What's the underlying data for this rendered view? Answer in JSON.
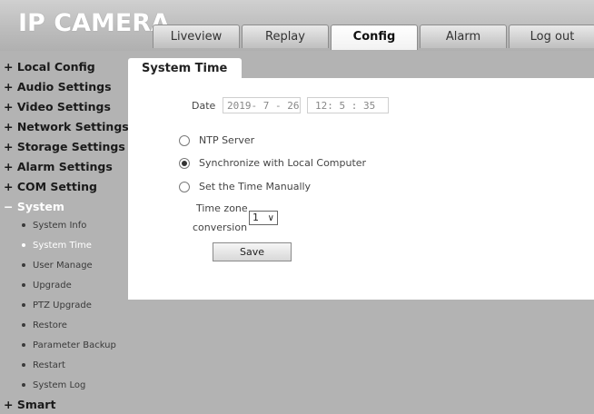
{
  "logo": "IP CAMERA",
  "tabs": [
    {
      "label": "Liveview"
    },
    {
      "label": "Replay"
    },
    {
      "label": "Config"
    },
    {
      "label": "Alarm"
    },
    {
      "label": "Log out"
    }
  ],
  "sidebar": {
    "items": [
      {
        "label": "+ Local Config"
      },
      {
        "label": "+ Audio Settings"
      },
      {
        "label": "+ Video Settings"
      },
      {
        "label": "+ Network Settings"
      },
      {
        "label": "+ Storage Settings"
      },
      {
        "label": "+ Alarm Settings"
      },
      {
        "label": "+ COM Setting"
      },
      {
        "label": "− System"
      }
    ],
    "system_sub": [
      {
        "label": "System Info"
      },
      {
        "label": "System Time"
      },
      {
        "label": "User Manage"
      },
      {
        "label": "Upgrade"
      },
      {
        "label": "PTZ Upgrade"
      },
      {
        "label": "Restore"
      },
      {
        "label": "Parameter Backup"
      },
      {
        "label": "Restart"
      },
      {
        "label": "System Log"
      }
    ],
    "last_item": "+ Smart"
  },
  "panel": {
    "title": "System Time",
    "date_label": "Date",
    "date_value": "2019- 7 - 26",
    "time_value": "12: 5 : 35",
    "options": [
      {
        "label": "NTP Server",
        "checked": false
      },
      {
        "label": "Synchronize with Local Computer",
        "checked": true
      },
      {
        "label": "Set the Time Manually",
        "checked": false
      }
    ],
    "timezone_label_line1": "Time zone",
    "timezone_label_line2": "conversion",
    "timezone_value": "1",
    "save_label": "Save"
  }
}
